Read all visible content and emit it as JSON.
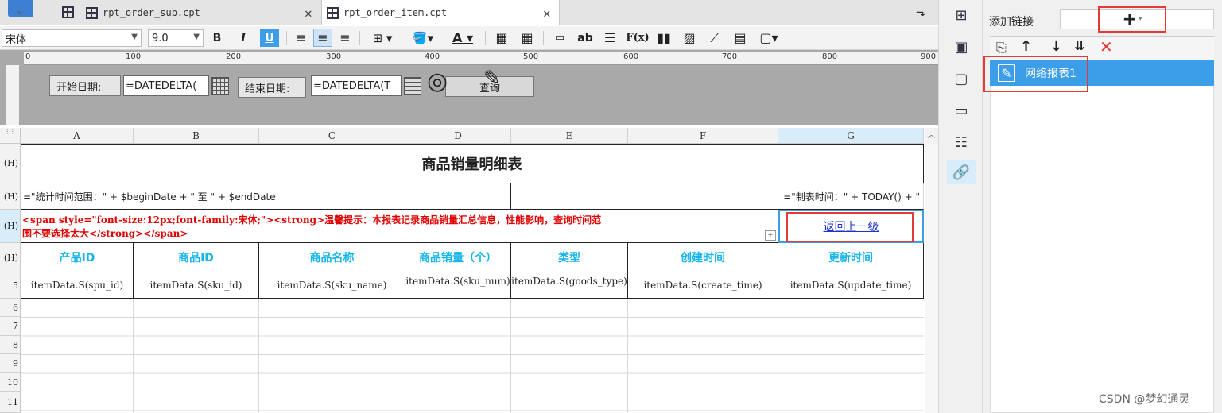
{
  "tabs": [
    {
      "label": "rpt_order_sub.cpt",
      "active": false
    },
    {
      "label": "rpt_order_item.cpt",
      "active": true
    }
  ],
  "toolbar": {
    "font_name": "宋体",
    "font_size": "9.0",
    "bold": "B",
    "italic": "I",
    "underline": "U",
    "text_a": "A",
    "ab": "ab",
    "fx": "F(x)"
  },
  "ruler": {
    "ticks": [
      "0",
      "100",
      "200",
      "300",
      "400",
      "500",
      "600",
      "700",
      "800",
      "900"
    ]
  },
  "params": {
    "start_label": "开始日期:",
    "start_value": "=DATEDELTA(",
    "end_label": "结束日期:",
    "end_value": "=DATEDELTA(T",
    "query_label": "查询"
  },
  "columns": [
    "A",
    "B",
    "C",
    "D",
    "E",
    "F",
    "G"
  ],
  "rows": {
    "r1_hdr": "(H)",
    "r2_hdr": "(H)",
    "r3_hdr": "(H)",
    "r4_hdr": "(H)",
    "r5_hdr": "5",
    "empty": [
      "6",
      "7",
      "8",
      "9",
      "10",
      "11"
    ]
  },
  "report": {
    "title": "商品销量明细表",
    "range_formula": "=\"统计时间范围：\" + $beginDate + \" 至 \" + $endDate",
    "made_formula": "=\"制表时间：\" + TODAY() + \"",
    "tip_line1": "<span style=\"font-size:12px;font-family:宋体;\"><strong>温馨提示：本报表记录商品销量汇总信息，性能影响，查询时间范",
    "tip_line2": "围不要选择太大</strong></span>",
    "back_link": "返回上一级",
    "headers": [
      "产品ID",
      "商品ID",
      "商品名称",
      "商品销量（个）",
      "类型",
      "创建时间",
      "更新时间"
    ],
    "data": [
      "itemData.S(spu_id)",
      "itemData.S(sku_id)",
      "itemData.S(sku_name)",
      "itemData.S(sku_num)",
      "itemData.S(goods_type)",
      "itemData.S(create_time)",
      "itemData.S(update_time)"
    ]
  },
  "link_panel": {
    "add_link_label": "添加链接",
    "add_button": "+",
    "item_label": "网络报表1"
  },
  "watermark": "CSDN @梦幻通灵",
  "colors": {
    "accent": "#3c9de8",
    "header_text": "#13b5ea",
    "tip_red": "#e00000",
    "highlight_box": "#e53935"
  }
}
